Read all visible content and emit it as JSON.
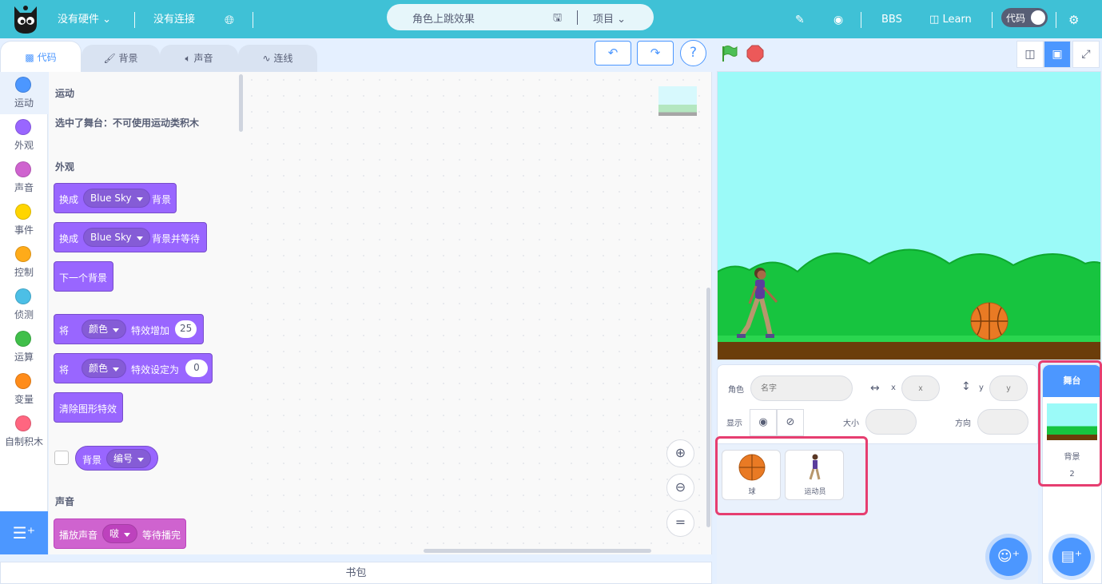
{
  "menubar": {
    "hardware": "没有硬件",
    "connection": "没有连接",
    "project_title": "角色上跳效果",
    "project_menu": "项目",
    "bbs": "BBS",
    "learn": "Learn",
    "code_toggle": "代码"
  },
  "tabs": [
    {
      "label": "代码",
      "icon": "code-icon"
    },
    {
      "label": "背景",
      "icon": "brush-icon"
    },
    {
      "label": "声音",
      "icon": "speaker-icon"
    },
    {
      "label": "连线",
      "icon": "wire-icon"
    }
  ],
  "toolbar": {
    "help": "?"
  },
  "categories": [
    {
      "label": "运动",
      "color": "#4c97ff"
    },
    {
      "label": "外观",
      "color": "#9966ff"
    },
    {
      "label": "声音",
      "color": "#cf63cf"
    },
    {
      "label": "事件",
      "color": "#ffd500"
    },
    {
      "label": "控制",
      "color": "#ffab19"
    },
    {
      "label": "侦测",
      "color": "#4cbfe6"
    },
    {
      "label": "运算",
      "color": "#40bf4a"
    },
    {
      "label": "变量",
      "color": "#ff8c1a"
    },
    {
      "label": "自制积木",
      "color": "#ff6680"
    }
  ],
  "palette": {
    "motion_heading": "运动",
    "motion_note": "选中了舞台：不可使用运动类积木",
    "looks_heading": "外观",
    "blocks": {
      "switch_backdrop": {
        "pre": "换成",
        "value": "Blue Sky",
        "post": "背景"
      },
      "switch_backdrop_wait": {
        "pre": "换成",
        "value": "Blue Sky",
        "post": "背景并等待"
      },
      "next_backdrop": "下一个背景",
      "change_effect": {
        "pre": "将",
        "value": "颜色",
        "mid": "特效增加",
        "num": "25"
      },
      "set_effect": {
        "pre": "将",
        "value": "颜色",
        "mid": "特效设定为",
        "num": "0"
      },
      "clear_effects": "清除图形特效",
      "backdrop_reporter": {
        "pre": "背景",
        "value": "编号"
      }
    },
    "sound_heading": "声音",
    "sound_block": {
      "pre": "播放声音",
      "value": "啵",
      "post": "等待播完"
    }
  },
  "backpack": "书包",
  "zoom": {
    "reset": "="
  },
  "sprite_info": {
    "sprite_label": "角色",
    "name_placeholder": "名字",
    "x_label": "x",
    "x_placeholder": "x",
    "y_label": "y",
    "y_placeholder": "y",
    "show_label": "显示",
    "size_label": "大小",
    "direction_label": "方向"
  },
  "sprites": [
    {
      "name": "球",
      "icon": "basketball-icon"
    },
    {
      "name": "运动员",
      "icon": "runner-icon"
    }
  ],
  "stage_pane": {
    "header": "舞台",
    "backdrop_label": "背景",
    "backdrop_count": "2"
  },
  "colors": {
    "topbar": "#3fc1d6",
    "accent": "#4c97ff",
    "highlight": "#e63e70",
    "looks": "#9966ff",
    "sound": "#cf63cf"
  }
}
